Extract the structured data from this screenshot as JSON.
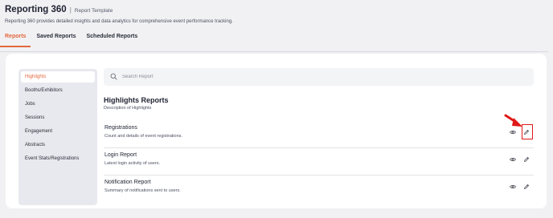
{
  "app": {
    "title": "Reporting 360",
    "separator": "|",
    "template_label": "Report Template",
    "description": "Reporting 360 provides detailed insights and data analytics for comprehensive event performance tracking."
  },
  "tabs": [
    {
      "label": "Reports",
      "active": true
    },
    {
      "label": "Saved Reports",
      "active": false
    },
    {
      "label": "Scheduled Reports",
      "active": false
    }
  ],
  "sidebar": {
    "items": [
      {
        "label": "Highlights",
        "active": true
      },
      {
        "label": "Booths/Exhibitors",
        "active": false
      },
      {
        "label": "Jobs",
        "active": false
      },
      {
        "label": "Sessions",
        "active": false
      },
      {
        "label": "Engagement",
        "active": false
      },
      {
        "label": "Abstracts",
        "active": false
      },
      {
        "label": "Event Stats/Registrations",
        "active": false
      }
    ]
  },
  "search": {
    "placeholder": "Search Report",
    "value": ""
  },
  "section": {
    "title": "Highlights Reports",
    "subtitle": "Description of Highlights"
  },
  "reports": [
    {
      "name": "Registrations",
      "description": "Count and details of event registrations."
    },
    {
      "name": "Login Report",
      "description": "Latest login activity of users."
    },
    {
      "name": "Notification Report",
      "description": "Summary of notifications sent to users."
    }
  ],
  "icons": {
    "search": "search-icon",
    "view": "eye-icon",
    "edit": "pencil-icon",
    "annotation": "red-arrow-icon"
  },
  "colors": {
    "accent": "#e2673d",
    "annotation": "#e01818",
    "background": "#f1f1f3",
    "sidebar": "#e8e9ee"
  }
}
